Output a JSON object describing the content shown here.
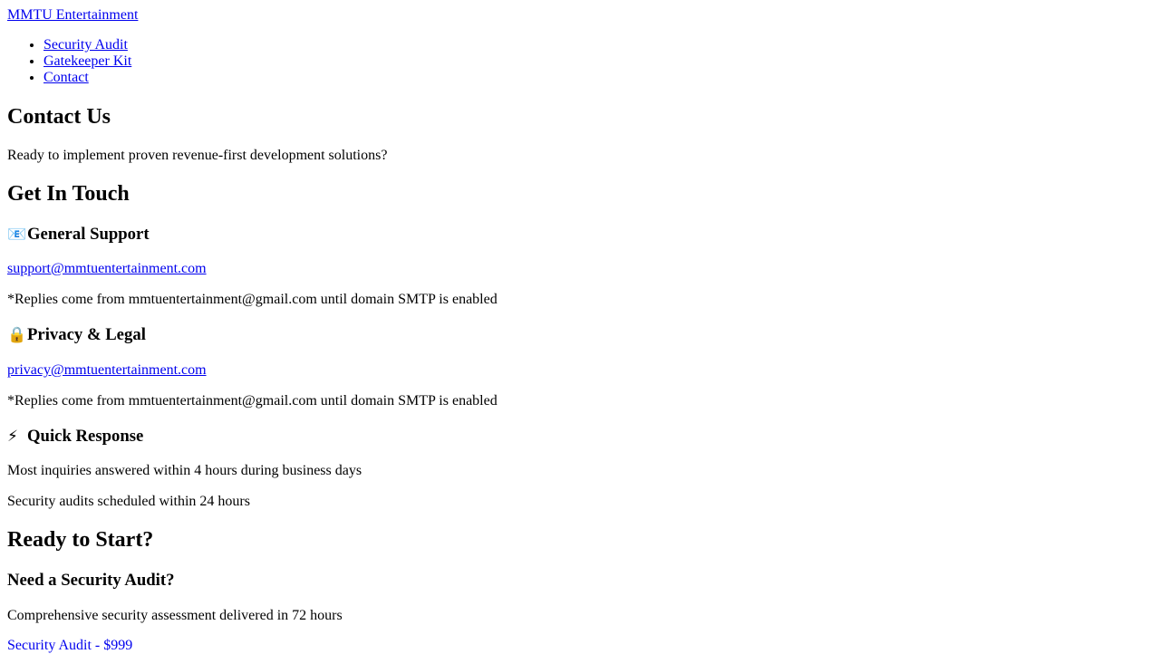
{
  "header": {
    "brand": "MMTU Entertainment",
    "nav": [
      {
        "label": "Security Audit"
      },
      {
        "label": "Gatekeeper Kit"
      },
      {
        "label": "Contact"
      }
    ]
  },
  "hero": {
    "title": "Contact Us",
    "subtitle": "Ready to implement proven revenue-first development solutions?"
  },
  "contact": {
    "title": "Get In Touch",
    "general": {
      "icon": "envelope-icon",
      "icon_glyph": "📧",
      "title": "General Support",
      "email": "support@mmtuentertainment.com",
      "note": "*Replies come from mmtuentertainment@gmail.com until domain SMTP is enabled"
    },
    "privacy": {
      "icon": "lock-icon",
      "icon_glyph": "🔒",
      "title": "Privacy & Legal",
      "email": "privacy@mmtuentertainment.com",
      "note": "*Replies come from mmtuentertainment@gmail.com until domain SMTP is enabled"
    },
    "response": {
      "icon": "lightning-icon",
      "icon_glyph": "⚡",
      "title": "Quick Response",
      "line1": "Most inquiries answered within 4 hours during business days",
      "line2": "Security audits scheduled within 24 hours"
    }
  },
  "cta": {
    "title": "Ready to Start?",
    "audit": {
      "title": "Need a Security Audit?",
      "description": "Comprehensive security assessment delivered in 72 hours",
      "link": "Security Audit - $999"
    }
  }
}
